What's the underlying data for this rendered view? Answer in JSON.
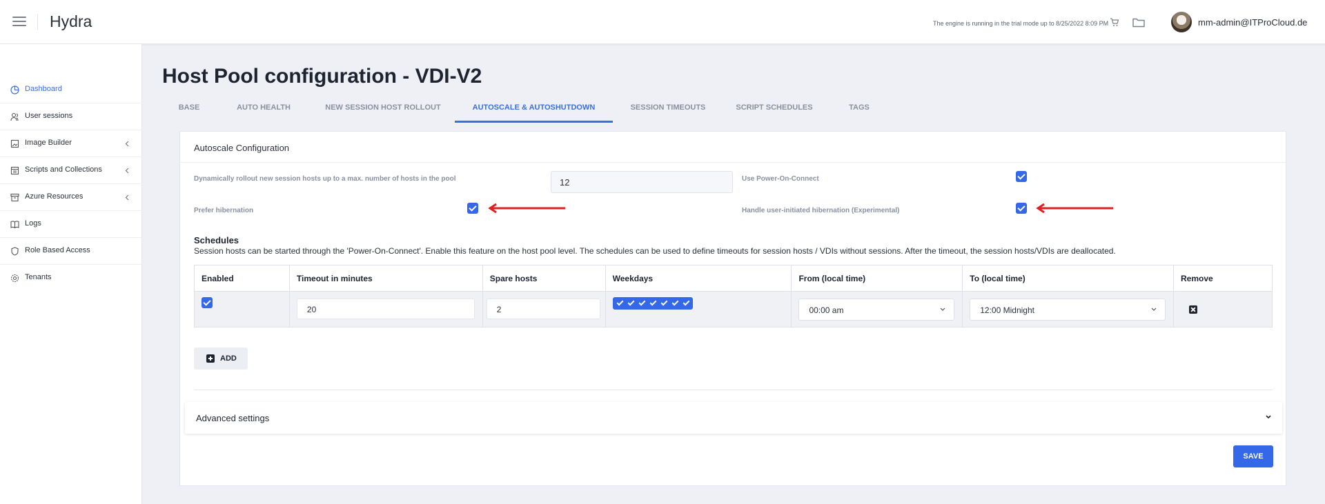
{
  "app": {
    "title": "Hydra",
    "trial_notice": "The engine is running in the trial mode up to 8/25/2022 8:09 PM",
    "user": "mm-admin@ITProCloud.de"
  },
  "sidebar": {
    "items": [
      {
        "label": "Dashboard",
        "icon": "dashboard-icon",
        "active": true
      },
      {
        "label": "User sessions",
        "icon": "users-icon"
      },
      {
        "label": "Image Builder",
        "icon": "image-icon",
        "has_children": true
      },
      {
        "label": "Scripts and Collections",
        "icon": "scripts-icon",
        "has_children": true
      },
      {
        "label": "Azure Resources",
        "icon": "archive-icon",
        "has_children": true
      },
      {
        "label": "Logs",
        "icon": "book-icon"
      },
      {
        "label": "Role Based Access",
        "icon": "shield-icon"
      },
      {
        "label": "Tenants",
        "icon": "gear-icon"
      }
    ]
  },
  "page": {
    "title": "Host Pool configuration - VDI-V2",
    "tabs": [
      {
        "label": "BASE"
      },
      {
        "label": "AUTO HEALTH"
      },
      {
        "label": "NEW SESSION HOST ROLLOUT"
      },
      {
        "label": "AUTOSCALE & AUTOSHUTDOWN",
        "active": true
      },
      {
        "label": "SESSION TIMEOUTS"
      },
      {
        "label": "SCRIPT SCHEDULES"
      },
      {
        "label": "TAGS"
      }
    ]
  },
  "autoscale": {
    "header": "Autoscale Configuration",
    "max_hosts_label": "Dynamically rollout new session hosts up to a max. number of hosts in the pool",
    "max_hosts_value": "12",
    "power_on_connect_label": "Use Power-On-Connect",
    "power_on_connect_checked": true,
    "prefer_hibernation_label": "Prefer hibernation",
    "prefer_hibernation_checked": true,
    "handle_hibernation_label": "Handle user-initiated hibernation (Experimental)",
    "handle_hibernation_checked": true
  },
  "schedules": {
    "title": "Schedules",
    "description": "Session hosts can be started through the 'Power-On-Connect'. Enable this feature on the host pool level. The schedules can be used to define timeouts for session hosts / VDIs without sessions. After the timeout, the session hosts/VDIs are deallocated.",
    "columns": [
      "Enabled",
      "Timeout in minutes",
      "Spare hosts",
      "Weekdays",
      "From (local time)",
      "To (local time)",
      "Remove"
    ],
    "rows": [
      {
        "enabled": true,
        "timeout": "20",
        "spare_hosts": "2",
        "weekdays_checked": 7,
        "from": "00:00 am",
        "to": "12:00 Midnight"
      }
    ],
    "add_label": "ADD"
  },
  "advanced": {
    "label": "Advanced settings"
  },
  "actions": {
    "save_label": "SAVE"
  },
  "colors": {
    "accent": "#3468e8",
    "annotation_arrow": "#e02020"
  }
}
